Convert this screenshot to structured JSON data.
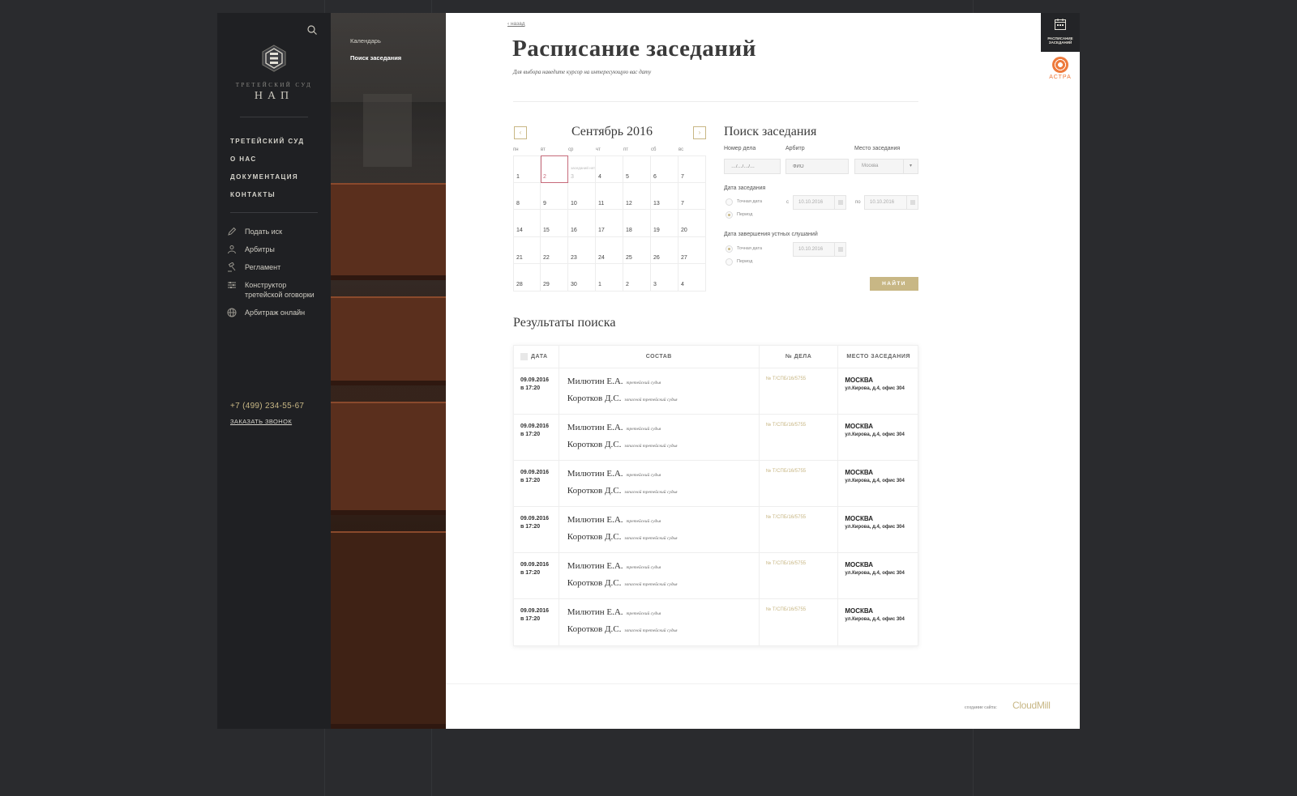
{
  "sidebar": {
    "logo_subtitle": "ТРЕТЕЙСКИЙ СУД",
    "logo_name": "НАП",
    "main_nav": [
      "ТРЕТЕЙСКИЙ СУД",
      "О НАС",
      "ДОКУМЕНТАЦИЯ",
      "КОНТАКТЫ"
    ],
    "sub_nav": [
      {
        "label": "Подать иск",
        "icon": "pen-icon"
      },
      {
        "label": "Арбитры",
        "icon": "people-icon"
      },
      {
        "label": "Регламент",
        "icon": "gavel-icon"
      },
      {
        "label": "Конструктор третейской оговорки",
        "icon": "sliders-icon"
      },
      {
        "label": "Арбитраж онлайн",
        "icon": "globe-icon"
      }
    ],
    "phone": "+7 (499) 234-55-67",
    "callback": "ЗАКАЗАТЬ ЗВОНОК"
  },
  "photo_nav": {
    "items": [
      "Календарь",
      "Поиск заседания"
    ],
    "active": "Поиск заседания"
  },
  "content": {
    "back": "‹ назад",
    "title": "Расписание заседаний",
    "subtitle": "Для выбора наведите курсор на интересующую вас дату"
  },
  "calendar": {
    "month": "Сентябрь 2016",
    "prev": "‹",
    "next": "›",
    "weekdays": [
      "пн",
      "вт",
      "ср",
      "чт",
      "пт",
      "сб",
      "вс"
    ],
    "weeks": [
      [
        "1",
        "2",
        "3",
        "4",
        "5",
        "6",
        "7"
      ],
      [
        "8",
        "9",
        "10",
        "11",
        "12",
        "13",
        "7"
      ],
      [
        "14",
        "15",
        "16",
        "17",
        "18",
        "19",
        "20"
      ],
      [
        "21",
        "22",
        "23",
        "24",
        "25",
        "26",
        "27"
      ],
      [
        "28",
        "29",
        "30",
        "1",
        "2",
        "3",
        "4"
      ]
    ],
    "note_text": "заседаний нет",
    "accent": "#c66a7a"
  },
  "search": {
    "title": "Поиск заседания",
    "case_label": "Номер дела",
    "case_placeholder": "…/…/…/…",
    "arbiter_label": "Арбитр",
    "arbiter_placeholder": "ФИО",
    "place_label": "Место заседания",
    "place_value": "Москва",
    "date_label": "Дата заседания",
    "exact_date": "Точная дата",
    "period": "Период",
    "from": "с",
    "to": "по",
    "date_from": "10.10.2016",
    "date_to": "10.10.2016",
    "hearings_label": "Дата завершения устных слушаний",
    "hearings_date": "10.10.2016",
    "submit": "НАЙТИ",
    "accent": "#c8b785"
  },
  "results": {
    "title": "Результаты поиска",
    "headers": [
      "ДАТА",
      "СОСТАВ",
      "№ ДЕЛА",
      "МЕСТО ЗАСЕДАНИЯ"
    ],
    "rows": [
      {
        "date": "09.09.2016",
        "time": "в 17:20",
        "judge1": "Милютин Е.А.",
        "role1": "третейский судья",
        "judge2": "Коротков Д.С.",
        "role2": "запасной третейский судья",
        "case": "№ Т/СПБ/16/5755",
        "city": "МОСКВА",
        "address": "ул.Кирова, д.4, офис 304"
      },
      {
        "date": "09.09.2016",
        "time": "в 17:20",
        "judge1": "Милютин Е.А.",
        "role1": "третейский судья",
        "judge2": "Коротков Д.С.",
        "role2": "запасной третейский судья",
        "case": "№ Т/СПБ/16/5755",
        "city": "МОСКВА",
        "address": "ул.Кирова, д.4, офис 304"
      },
      {
        "date": "09.09.2016",
        "time": "в 17:20",
        "judge1": "Милютин Е.А.",
        "role1": "третейский судья",
        "judge2": "Коротков Д.С.",
        "role2": "запасной третейский судья",
        "case": "№ Т/СПБ/16/5755",
        "city": "МОСКВА",
        "address": "ул.Кирова, д.4, офис 304"
      },
      {
        "date": "09.09.2016",
        "time": "в 17:20",
        "judge1": "Милютин Е.А.",
        "role1": "третейский судья",
        "judge2": "Коротков Д.С.",
        "role2": "запасной третейский судья",
        "case": "№ Т/СПБ/16/5755",
        "city": "МОСКВА",
        "address": "ул.Кирова, д.4, офис 304"
      },
      {
        "date": "09.09.2016",
        "time": "в 17:20",
        "judge1": "Милютин Е.А.",
        "role1": "третейский судья",
        "judge2": "Коротков Д.С.",
        "role2": "запасной третейский судья",
        "case": "№ Т/СПБ/16/5755",
        "city": "МОСКВА",
        "address": "ул.Кирова, д.4, офис 304"
      },
      {
        "date": "09.09.2016",
        "time": "в 17:20",
        "judge1": "Милютин Е.А.",
        "role1": "третейский судья",
        "judge2": "Коротков Д.С.",
        "role2": "запасной третейский судья",
        "case": "№ Т/СПБ/16/5755",
        "city": "МОСКВА",
        "address": "ул.Кирова, д.4, офис 304"
      }
    ]
  },
  "footer": {
    "made_by": "создание сайта:",
    "studio": "CloudMill"
  },
  "widgets": {
    "schedule": "РАСПИСАНИЕ ЗАСЕДАНИЙ",
    "astra": "АСТРА",
    "astra_color": "#ee7a3c"
  }
}
